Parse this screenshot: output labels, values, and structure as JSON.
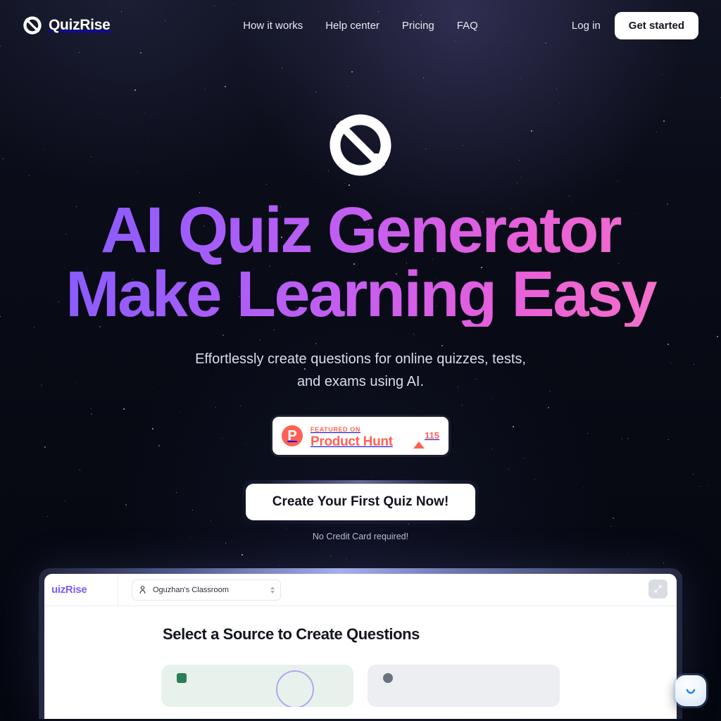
{
  "brand": {
    "name": "QuizRise",
    "logo_icon": "quizrise-slashed-circle-logo",
    "accent": "#7b5cf0"
  },
  "nav": {
    "links": [
      {
        "label": "How it works"
      },
      {
        "label": "Help center"
      },
      {
        "label": "Pricing"
      },
      {
        "label": "FAQ"
      }
    ],
    "login_label": "Log in",
    "get_started_label": "Get started"
  },
  "hero": {
    "logo_icon": "quizrise-slashed-circle-mark",
    "headline_line1": "AI Quiz Generator",
    "headline_line2": "Make Learning Easy",
    "headline_gradient_from": "#7a5bff",
    "headline_gradient_to": "#f977c2",
    "subtitle": "Effortlessly create questions for online quizzes, tests, and exams using AI.",
    "cta_label": "Create Your First Quiz Now!",
    "cta_note": "No Credit Card required!"
  },
  "product_hunt": {
    "icon": "product-hunt-p-icon",
    "featured_label": "FEATURED ON",
    "name": "Product Hunt",
    "upvote_icon": "upvote-triangle-icon",
    "upvotes": "115",
    "brand_color": "#ff6154"
  },
  "app_preview": {
    "logo_text": "uizRise",
    "classroom": {
      "icon": "user-group-icon",
      "value": "Oguzhan's Classroom",
      "caret_icon": "chevron-updown-icon"
    },
    "expand_icon": "expand-arrows-icon",
    "heading": "Select a Source to Create Questions",
    "cards": [
      {
        "icon": "document-green-icon",
        "accent": "#2e7d5b"
      },
      {
        "icon": "source-grey-icon",
        "accent": "#6d7280"
      }
    ]
  },
  "chat_widget": {
    "icon": "smile-chat-icon"
  }
}
